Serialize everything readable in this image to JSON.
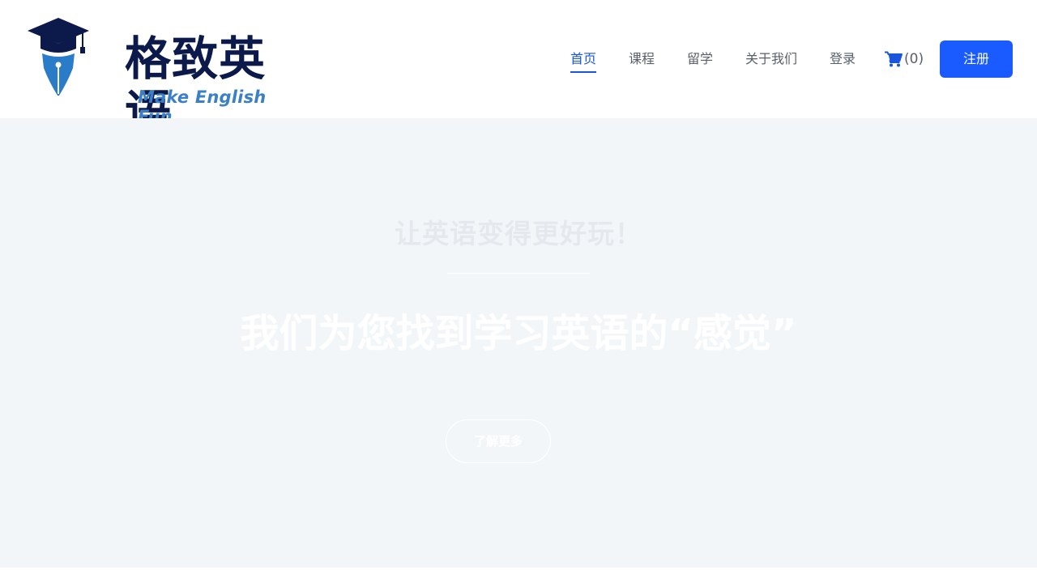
{
  "brand": {
    "name": "格致英语",
    "slogan": "Make English Fun",
    "colors": {
      "navy": "#0c1a4b",
      "blue": "#3b7fc6"
    }
  },
  "nav": {
    "items": [
      {
        "label": "首页",
        "active": true
      },
      {
        "label": "课程",
        "active": false
      },
      {
        "label": "留学",
        "active": false
      },
      {
        "label": "关于我们",
        "active": false
      },
      {
        "label": "登录",
        "active": false
      }
    ],
    "cart_icon": "shopping-cart-icon",
    "cart_count": "(0)",
    "register_label": "注册",
    "accent_color": "#1a5bff"
  },
  "hero": {
    "subtitle": "让英语变得更好玩！",
    "title": "我们为您找到学习英语的“感觉”",
    "button_label": "了解更多",
    "background": "#f3f6f9"
  }
}
